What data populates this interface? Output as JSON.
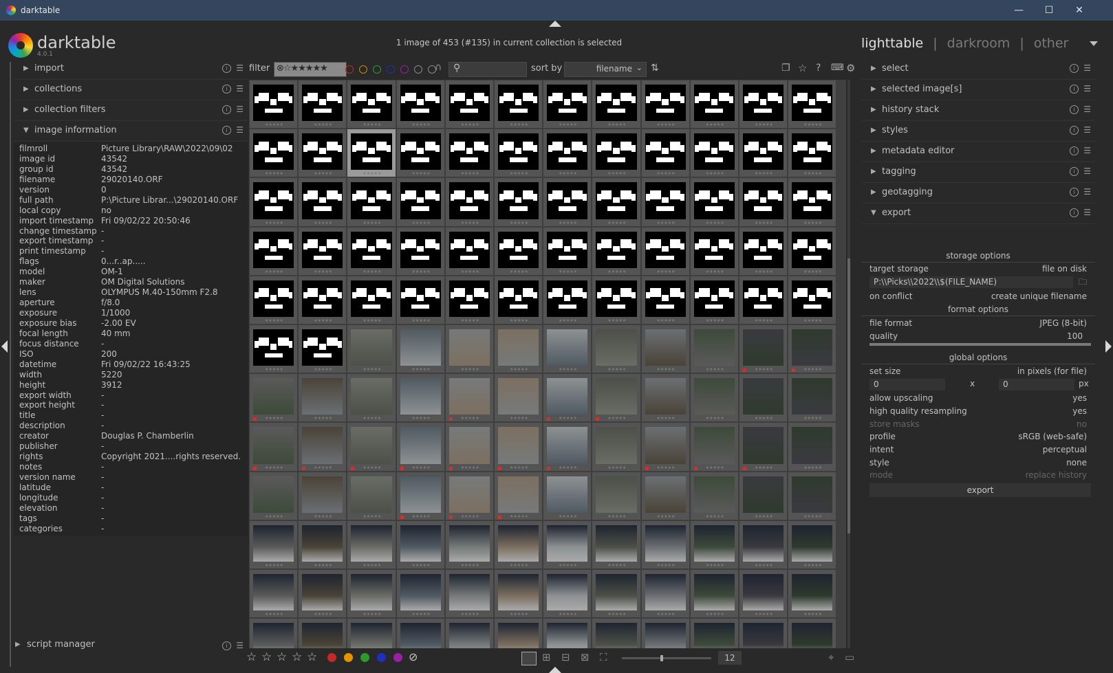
{
  "window": {
    "title": "darktable",
    "minimize": "—",
    "maximize": "☐",
    "close": "✕"
  },
  "logo": {
    "name": "darktable",
    "version": "4.0.1"
  },
  "selection_info": "1 image of 453 (#135) in current collection is selected",
  "views": {
    "lighttable": "lighttable",
    "darkroom": "darkroom",
    "other": "other",
    "sep": "|"
  },
  "left_modules": [
    {
      "label": "import",
      "expanded": false
    },
    {
      "label": "collections",
      "expanded": false
    },
    {
      "label": "collection filters",
      "expanded": false
    },
    {
      "label": "image information",
      "expanded": true
    }
  ],
  "image_information": [
    {
      "key": "filmroll",
      "value": "Picture Library\\RAW\\2022\\09\\02"
    },
    {
      "key": "image id",
      "value": "43542"
    },
    {
      "key": "group id",
      "value": "43542"
    },
    {
      "key": "filename",
      "value": "29020140.ORF"
    },
    {
      "key": "version",
      "value": "0"
    },
    {
      "key": "full path",
      "value": "P:\\Picture Librar...\\29020140.ORF"
    },
    {
      "key": "local copy",
      "value": "no"
    },
    {
      "key": "import timestamp",
      "value": "Fri 09/02/22 20:50:46"
    },
    {
      "key": "change timestamp",
      "value": "-"
    },
    {
      "key": "export timestamp",
      "value": "-"
    },
    {
      "key": "print timestamp",
      "value": "-"
    },
    {
      "key": "flags",
      "value": "0...r..ap....."
    },
    {
      "key": "model",
      "value": "OM-1"
    },
    {
      "key": "maker",
      "value": "OM Digital Solutions"
    },
    {
      "key": "lens",
      "value": "OLYMPUS M.40-150mm F2.8"
    },
    {
      "key": "aperture",
      "value": "f/8.0"
    },
    {
      "key": "exposure",
      "value": "1/1000"
    },
    {
      "key": "exposure bias",
      "value": "-2.00 EV"
    },
    {
      "key": "focal length",
      "value": "40 mm"
    },
    {
      "key": "focus distance",
      "value": "-"
    },
    {
      "key": "ISO",
      "value": "200"
    },
    {
      "key": "datetime",
      "value": "Fri 09/02/22 16:43:25"
    },
    {
      "key": "width",
      "value": "5220"
    },
    {
      "key": "height",
      "value": "3912"
    },
    {
      "key": "export width",
      "value": "-"
    },
    {
      "key": "export height",
      "value": "-"
    },
    {
      "key": "title",
      "value": "-"
    },
    {
      "key": "description",
      "value": "-"
    },
    {
      "key": "creator",
      "value": "Douglas P. Chamberlin"
    },
    {
      "key": "publisher",
      "value": "-"
    },
    {
      "key": "rights",
      "value": "Copyright 2021....rights reserved."
    },
    {
      "key": "notes",
      "value": "-"
    },
    {
      "key": "version name",
      "value": "-"
    },
    {
      "key": "latitude",
      "value": "-"
    },
    {
      "key": "longitude",
      "value": "-"
    },
    {
      "key": "elevation",
      "value": "-"
    },
    {
      "key": "tags",
      "value": "-"
    },
    {
      "key": "categories",
      "value": "-"
    }
  ],
  "script_manager": "script manager",
  "filter_bar": {
    "filter_label": "filter",
    "rating_stars": "⊗☆★★★★★",
    "search_placeholder": "",
    "sort_label": "sort by",
    "sort_value": "filename",
    "color_labels": [
      "#c62828",
      "#c68a00",
      "#2e9a2e",
      "#1f2fbf",
      "#9a1fa3",
      "#8a8a8a",
      "#8a8a8a"
    ]
  },
  "grid": {
    "columns": 12,
    "selected_index": 14
  },
  "right_modules": [
    {
      "label": "select",
      "expanded": false
    },
    {
      "label": "selected image[s]",
      "expanded": false
    },
    {
      "label": "history stack",
      "expanded": false
    },
    {
      "label": "styles",
      "expanded": false
    },
    {
      "label": "metadata editor",
      "expanded": false
    },
    {
      "label": "tagging",
      "expanded": false
    },
    {
      "label": "geotagging",
      "expanded": false
    },
    {
      "label": "export",
      "expanded": true
    }
  ],
  "export": {
    "storage_options": "storage options",
    "target_storage_label": "target storage",
    "target_storage_value": "file on disk",
    "path": "P:\\\\Picks\\\\2022\\\\$(FILE_NAME)",
    "on_conflict_label": "on conflict",
    "on_conflict_value": "create unique filename",
    "format_options": "format options",
    "file_format_label": "file format",
    "file_format_value": "JPEG (8-bit)",
    "quality_label": "quality",
    "quality_value": "100",
    "global_options": "global options",
    "set_size_label": "set size",
    "set_size_value": "in pixels (for file)",
    "width_value": "0",
    "x_label": "x",
    "height_value": "0",
    "px_label": "px",
    "allow_upscaling_label": "allow upscaling",
    "allow_upscaling_value": "yes",
    "hq_resampling_label": "high quality resampling",
    "hq_resampling_value": "yes",
    "store_masks_label": "store masks",
    "store_masks_value": "no",
    "profile_label": "profile",
    "profile_value": "sRGB (web-safe)",
    "intent_label": "intent",
    "intent_value": "perceptual",
    "style_label": "style",
    "style_value": "none",
    "mode_label": "mode",
    "mode_value": "replace history",
    "export_button": "export"
  },
  "bottom_bar": {
    "stars": [
      "☆",
      "☆",
      "☆",
      "☆",
      "☆"
    ],
    "color_dots": [
      "#c62828",
      "#e69500",
      "#2e9a2e",
      "#1f2fbf",
      "#9a1fa3"
    ],
    "reject": "⊘",
    "zoom_value": "12"
  }
}
